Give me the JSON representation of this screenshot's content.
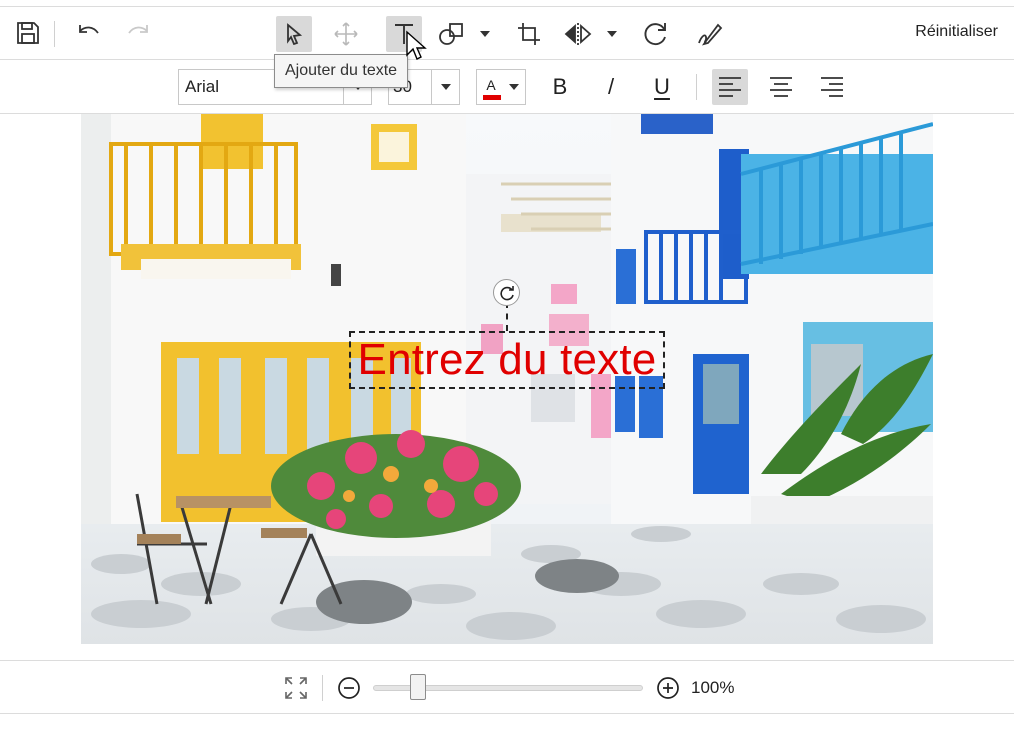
{
  "toolbar": {
    "save_icon": "save-icon",
    "undo_icon": "undo-icon",
    "redo_icon": "redo-icon",
    "select_icon": "pointer-icon",
    "pan_icon": "move-icon",
    "text_icon": "text-tool-icon",
    "shape_icon": "shapes-icon",
    "crop_icon": "crop-icon",
    "flip_icon": "flip-icon",
    "rotate_icon": "rotate-icon",
    "draw_icon": "freehand-draw-icon",
    "reset_label": "Réinitialiser",
    "tooltip": "Ajouter du texte"
  },
  "text_toolbar": {
    "font_family": "Arial",
    "font_size": "30",
    "font_color": "#e00000",
    "font_color_label": "A",
    "bold_label": "B",
    "italic_label": "/",
    "underline_label": "U",
    "alignment": "left"
  },
  "canvas": {
    "annotation_text": "Entrez du texte",
    "annotation_color": "#e00000"
  },
  "footer": {
    "zoom_label": "100%",
    "zoom_fraction": 0.14
  },
  "colors": {
    "accent_text": "#e00000",
    "active_button": "#d9d9d9"
  }
}
